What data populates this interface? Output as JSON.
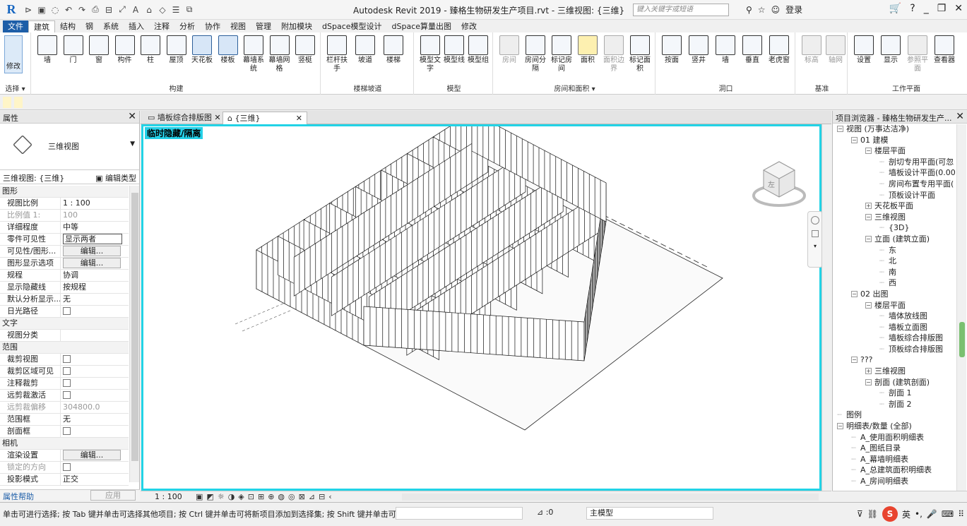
{
  "window": {
    "title": "Autodesk Revit 2019 - 臻格生物研发生产项目.rvt - 三维视图: {三维}",
    "search_placeholder": "键入关键字或短语",
    "login": "登录"
  },
  "ribbon_tabs": [
    "文件",
    "建筑",
    "结构",
    "钢",
    "系统",
    "插入",
    "注释",
    "分析",
    "协作",
    "视图",
    "管理",
    "附加模块",
    "dSpace模型设计",
    "dSpace算量出图",
    "修改"
  ],
  "ribbon": {
    "select": {
      "modify": "修改",
      "label": "选择 ▾"
    },
    "build": {
      "label": "构建",
      "buttons": [
        "墙",
        "门",
        "窗",
        "构件",
        "柱",
        "屋顶",
        "天花板",
        "楼板",
        "幕墙系统",
        "幕墙网格",
        "竖梃"
      ]
    },
    "stairs": {
      "label": "楼梯坡道",
      "buttons": [
        "栏杆扶手",
        "坡道",
        "楼梯"
      ]
    },
    "model": {
      "label": "模型",
      "buttons": [
        "模型文字",
        "模型线",
        "模型组"
      ]
    },
    "room": {
      "label": "房间和面积 ▾",
      "buttons": [
        "房间",
        "房间分隔",
        "标记房间",
        "面积",
        "面积边界",
        "标记面积"
      ]
    },
    "opening": {
      "label": "洞口",
      "buttons": [
        "按面",
        "竖井",
        "墙",
        "垂直",
        "老虎窗"
      ]
    },
    "datum": {
      "label": "基准",
      "buttons": [
        "标高",
        "轴网"
      ]
    },
    "workplane": {
      "label": "工作平面",
      "buttons": [
        "设置",
        "显示",
        "参照平面",
        "查看器"
      ]
    }
  },
  "properties": {
    "title": "属性",
    "type_name": "三维视图",
    "selector": "三维视图: {三维}",
    "edit_type": "编辑类型",
    "rows": [
      {
        "cat": "图形"
      },
      {
        "k": "视图比例",
        "v": "1 : 100"
      },
      {
        "k": "比例值 1:",
        "v": "100",
        "dis": true
      },
      {
        "k": "详细程度",
        "v": "中等"
      },
      {
        "k": "零件可见性",
        "v": "显示两者",
        "input": true
      },
      {
        "k": "可见性/图形...",
        "btn": "编辑..."
      },
      {
        "k": "图形显示选项",
        "btn": "编辑..."
      },
      {
        "k": "规程",
        "v": "协调"
      },
      {
        "k": "显示隐藏线",
        "v": "按规程"
      },
      {
        "k": "默认分析显示...",
        "v": "无"
      },
      {
        "k": "日光路径",
        "chk": true
      },
      {
        "cat": "文字"
      },
      {
        "k": "视图分类",
        "v": ""
      },
      {
        "cat": "范围"
      },
      {
        "k": "裁剪视图",
        "chk": true
      },
      {
        "k": "裁剪区域可见",
        "chk": true
      },
      {
        "k": "注释裁剪",
        "chk": true
      },
      {
        "k": "远剪裁激活",
        "chk": true
      },
      {
        "k": "远剪裁偏移",
        "v": "304800.0",
        "dis": true
      },
      {
        "k": "范围框",
        "v": "无"
      },
      {
        "k": "剖面框",
        "chk": true
      },
      {
        "cat": "相机"
      },
      {
        "k": "渲染设置",
        "btn": "编辑..."
      },
      {
        "k": "锁定的方向",
        "chk": true,
        "dis": true
      },
      {
        "k": "投影模式",
        "v": "正交"
      }
    ],
    "help": "属性帮助",
    "apply": "应用"
  },
  "doc_tabs": [
    "墙板综合排版图",
    "{三维}"
  ],
  "viewport": {
    "temp_label": "临时隐藏/隔离",
    "scale": "1 : 100",
    "cube_face": "左"
  },
  "browser": {
    "title": "项目浏览器 - 臻格生物研发生产...",
    "tree": [
      {
        "d": 0,
        "t": "视图 (万事达洁净)",
        "tg": "−"
      },
      {
        "d": 1,
        "t": "01 建模",
        "tg": "−"
      },
      {
        "d": 2,
        "t": "楼层平面",
        "tg": "−"
      },
      {
        "d": 3,
        "t": "剖切专用平面(可忽"
      },
      {
        "d": 3,
        "t": "墙板设计平面(0.00"
      },
      {
        "d": 3,
        "t": "房间布置专用平面("
      },
      {
        "d": 3,
        "t": "顶板设计平面"
      },
      {
        "d": 2,
        "t": "天花板平面",
        "tg": "+"
      },
      {
        "d": 2,
        "t": "三维视图",
        "tg": "−"
      },
      {
        "d": 3,
        "t": "{3D}"
      },
      {
        "d": 2,
        "t": "立面 (建筑立面)",
        "tg": "−"
      },
      {
        "d": 3,
        "t": "东"
      },
      {
        "d": 3,
        "t": "北"
      },
      {
        "d": 3,
        "t": "南"
      },
      {
        "d": 3,
        "t": "西"
      },
      {
        "d": 1,
        "t": "02 出图",
        "tg": "−"
      },
      {
        "d": 2,
        "t": "楼层平面",
        "tg": "−"
      },
      {
        "d": 3,
        "t": "墙体放线图"
      },
      {
        "d": 3,
        "t": "墙板立面图"
      },
      {
        "d": 3,
        "t": "墙板综合排版图"
      },
      {
        "d": 3,
        "t": "顶板综合排版图"
      },
      {
        "d": 1,
        "t": "???",
        "tg": "−"
      },
      {
        "d": 2,
        "t": "三维视图",
        "tg": "+"
      },
      {
        "d": 2,
        "t": "剖面 (建筑剖面)",
        "tg": "−"
      },
      {
        "d": 3,
        "t": "剖面 1"
      },
      {
        "d": 3,
        "t": "剖面 2"
      },
      {
        "d": 0,
        "t": "图例"
      },
      {
        "d": 0,
        "t": "明细表/数量 (全部)",
        "tg": "−"
      },
      {
        "d": 1,
        "t": "A_使用面积明细表"
      },
      {
        "d": 1,
        "t": "A_图纸目录"
      },
      {
        "d": 1,
        "t": "A_幕墙明细表"
      },
      {
        "d": 1,
        "t": "A_总建筑面积明细表"
      },
      {
        "d": 1,
        "t": "A_房间明细表"
      }
    ]
  },
  "status": {
    "text": "单击可进行选择; 按 Tab 键并单击可选择其他项目; 按 Ctrl 键并单击可将新项目添加到选择集; 按 Shift 键并单击可",
    "zero": ":0",
    "model": "主模型",
    "ime": "英"
  }
}
